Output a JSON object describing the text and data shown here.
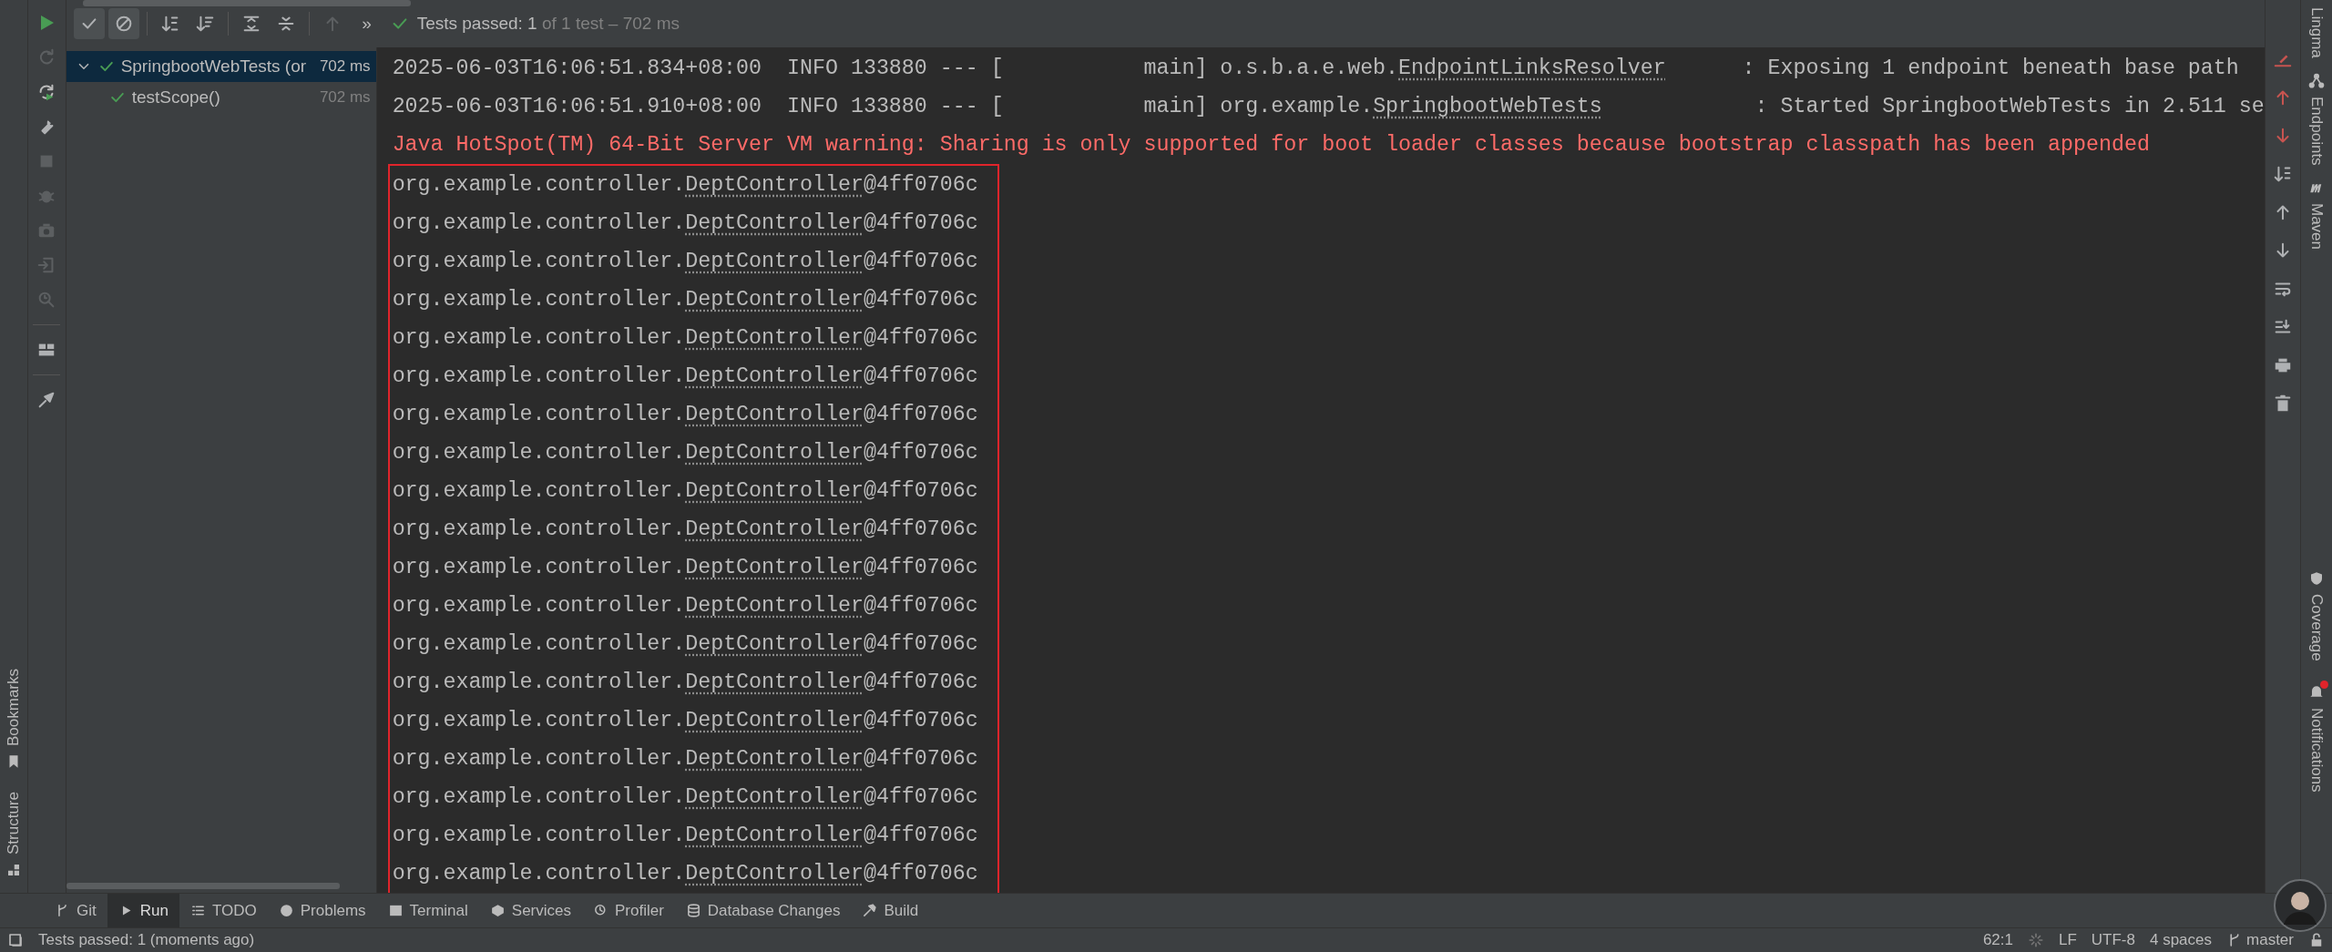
{
  "toolbar": {
    "buttons": [
      {
        "toggled": false,
        "disabled": false
      },
      {
        "toggled": true,
        "disabled": false
      },
      {
        "toggled": true,
        "disabled": false
      },
      {
        "toggled": false,
        "disabled": false
      },
      {
        "toggled": false,
        "disabled": false
      },
      {
        "toggled": false,
        "disabled": false
      },
      {
        "toggled": false,
        "disabled": false
      },
      {
        "toggled": false,
        "disabled": true
      }
    ],
    "overflow": "»",
    "passed": true,
    "summary": "Tests passed: 1",
    "summary_detail": "of 1 test – 702 ms"
  },
  "side_tools": [
    {
      "disabled": true
    },
    {
      "disabled": false
    },
    {
      "disabled": false
    },
    {
      "disabled": true
    },
    {
      "disabled": true
    },
    {
      "disabled": true
    },
    {
      "disabled": true
    },
    {
      "disabled": true
    },
    {
      "disabled": false
    },
    {
      "disabled": false
    }
  ],
  "tree": [
    {
      "label": "SpringbootWebTests (or",
      "time": "702 ms",
      "passed": true,
      "expanded": true,
      "selected": true,
      "children": [
        {
          "label": "testScope()",
          "time": "702 ms",
          "passed": true,
          "selected": false
        }
      ]
    }
  ],
  "console": {
    "lines": [
      {
        "kind": "log",
        "before": "2025-06-03T16:06:51.834+08:00  INFO 133880 --- [           main] o.s.b.a.e.web.",
        "link": "EndpointLinksResolver",
        "after": "      : Exposing 1 endpoint beneath base path"
      },
      {
        "kind": "log",
        "before": "2025-06-03T16:06:51.910+08:00  INFO 133880 --- [           main] org.example.",
        "link": "SpringbootWebTests",
        "after": "            : Started SpringbootWebTests in 2.511 se"
      },
      {
        "kind": "warning",
        "before": "Java HotSpot(TM) 64-Bit Server VM warning: Sharing is only supported for boot loader classes because bootstrap classpath has been appended"
      }
    ],
    "highlighted": [
      {
        "kind": "log",
        "before": "org.example.controller.",
        "link": "DeptController",
        "after": "@4ff0706c"
      },
      {
        "kind": "log",
        "before": "org.example.controller.",
        "link": "DeptController",
        "after": "@4ff0706c"
      },
      {
        "kind": "log",
        "before": "org.example.controller.",
        "link": "DeptController",
        "after": "@4ff0706c"
      },
      {
        "kind": "log",
        "before": "org.example.controller.",
        "link": "DeptController",
        "after": "@4ff0706c"
      },
      {
        "kind": "log",
        "before": "org.example.controller.",
        "link": "DeptController",
        "after": "@4ff0706c"
      },
      {
        "kind": "log",
        "before": "org.example.controller.",
        "link": "DeptController",
        "after": "@4ff0706c"
      },
      {
        "kind": "log",
        "before": "org.example.controller.",
        "link": "DeptController",
        "after": "@4ff0706c"
      },
      {
        "kind": "log",
        "before": "org.example.controller.",
        "link": "DeptController",
        "after": "@4ff0706c"
      },
      {
        "kind": "log",
        "before": "org.example.controller.",
        "link": "DeptController",
        "after": "@4ff0706c"
      },
      {
        "kind": "log",
        "before": "org.example.controller.",
        "link": "DeptController",
        "after": "@4ff0706c"
      },
      {
        "kind": "log",
        "before": "org.example.controller.",
        "link": "DeptController",
        "after": "@4ff0706c"
      },
      {
        "kind": "log",
        "before": "org.example.controller.",
        "link": "DeptController",
        "after": "@4ff0706c"
      },
      {
        "kind": "log",
        "before": "org.example.controller.",
        "link": "DeptController",
        "after": "@4ff0706c"
      },
      {
        "kind": "log",
        "before": "org.example.controller.",
        "link": "DeptController",
        "after": "@4ff0706c"
      },
      {
        "kind": "log",
        "before": "org.example.controller.",
        "link": "DeptController",
        "after": "@4ff0706c"
      },
      {
        "kind": "log",
        "before": "org.example.controller.",
        "link": "DeptController",
        "after": "@4ff0706c"
      },
      {
        "kind": "log",
        "before": "org.example.controller.",
        "link": "DeptController",
        "after": "@4ff0706c"
      },
      {
        "kind": "log",
        "before": "org.example.controller.",
        "link": "DeptController",
        "after": "@4ff0706c"
      },
      {
        "kind": "log",
        "before": "org.example.controller.",
        "link": "DeptController",
        "after": "@4ff0706c"
      }
    ]
  },
  "left_stripe": [
    "Bookmarks",
    "Structure"
  ],
  "right_stripe": {
    "top": [
      "Lingma",
      "Endpoints",
      "Maven"
    ],
    "bottom": [
      {
        "label": "Coverage",
        "unread": false
      },
      {
        "label": "Notifications",
        "unread": true
      }
    ]
  },
  "bottom_tabs": [
    {
      "label": "Git",
      "selected": false
    },
    {
      "label": "Run",
      "selected": true
    },
    {
      "label": "TODO",
      "selected": false
    },
    {
      "label": "Problems",
      "selected": false
    },
    {
      "label": "Terminal",
      "selected": false
    },
    {
      "label": "Services",
      "selected": false
    },
    {
      "label": "Profiler",
      "selected": false
    },
    {
      "label": "Database Changes",
      "selected": false
    },
    {
      "label": "Build",
      "selected": false
    }
  ],
  "status_bar": {
    "message": "Tests passed: 1 (moments ago)",
    "position": "62:1",
    "line_separator": "LF",
    "encoding": "UTF-8",
    "indent": "4 spaces",
    "branch": "master"
  }
}
